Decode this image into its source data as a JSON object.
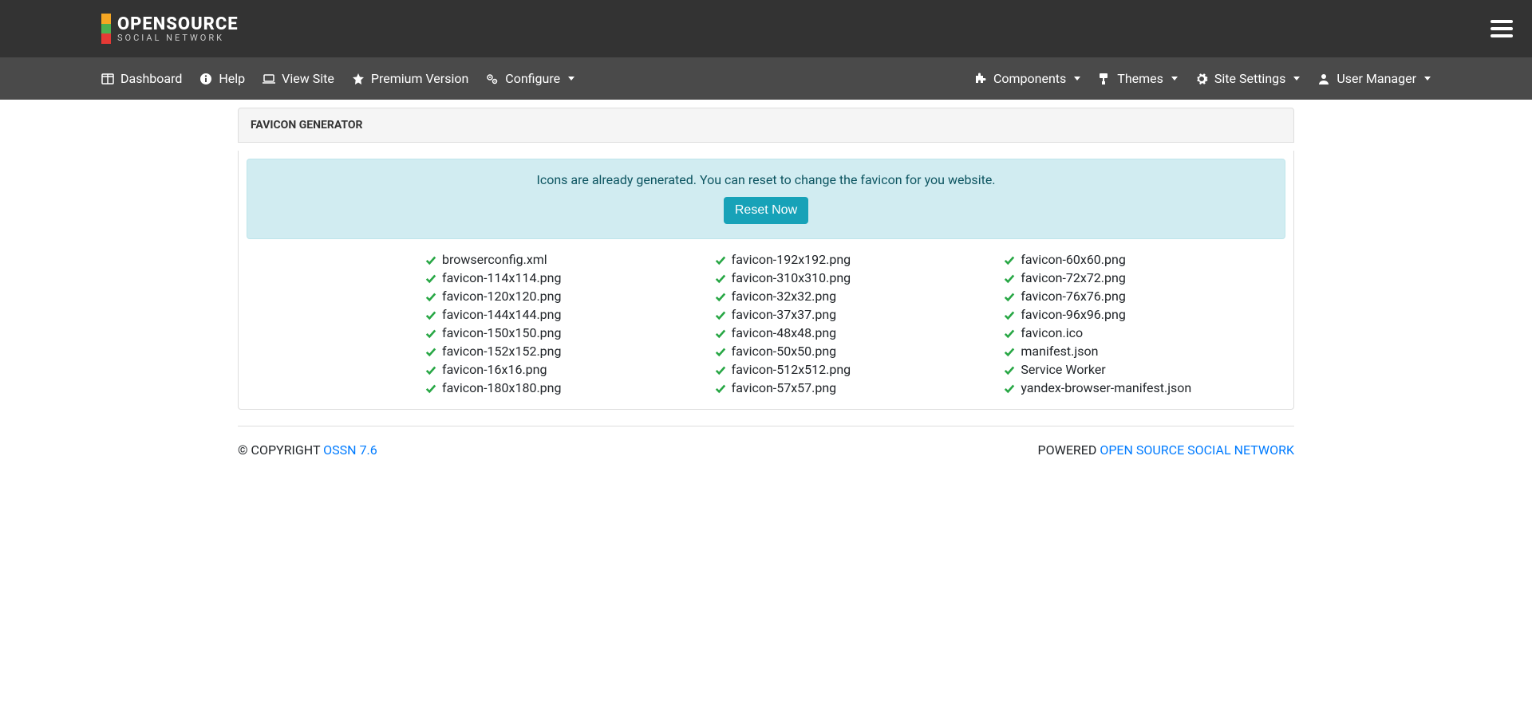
{
  "logo": {
    "line1": "OPENSOURCE",
    "line2": "SOCIAL NETWORK"
  },
  "nav": {
    "left": [
      {
        "key": "dashboard",
        "label": "Dashboard",
        "icon": "columns",
        "dropdown": false
      },
      {
        "key": "help",
        "label": "Help",
        "icon": "info",
        "dropdown": false
      },
      {
        "key": "view-site",
        "label": "View Site",
        "icon": "laptop",
        "dropdown": false
      },
      {
        "key": "premium",
        "label": "Premium Version",
        "icon": "star",
        "dropdown": false
      },
      {
        "key": "configure",
        "label": "Configure",
        "icon": "cogs",
        "dropdown": true
      }
    ],
    "right": [
      {
        "key": "components",
        "label": "Components",
        "icon": "puzzle",
        "dropdown": true
      },
      {
        "key": "themes",
        "label": "Themes",
        "icon": "paint",
        "dropdown": true
      },
      {
        "key": "site-settings",
        "label": "Site Settings",
        "icon": "cog",
        "dropdown": true
      },
      {
        "key": "user-manager",
        "label": "User Manager",
        "icon": "user",
        "dropdown": true
      }
    ]
  },
  "page": {
    "title": "FAVICON GENERATOR",
    "alert_text": "Icons are already generated. You can reset to change the favicon for you website.",
    "reset_button": "Reset Now"
  },
  "files": {
    "col1": [
      "browserconfig.xml",
      "favicon-114x114.png",
      "favicon-120x120.png",
      "favicon-144x144.png",
      "favicon-150x150.png",
      "favicon-152x152.png",
      "favicon-16x16.png",
      "favicon-180x180.png"
    ],
    "col2": [
      "favicon-192x192.png",
      "favicon-310x310.png",
      "favicon-32x32.png",
      "favicon-37x37.png",
      "favicon-48x48.png",
      "favicon-50x50.png",
      "favicon-512x512.png",
      "favicon-57x57.png"
    ],
    "col3": [
      "favicon-60x60.png",
      "favicon-72x72.png",
      "favicon-76x76.png",
      "favicon-96x96.png",
      "favicon.ico",
      "manifest.json",
      "Service Worker",
      "yandex-browser-manifest.json"
    ]
  },
  "footer": {
    "copyright_prefix": "© COPYRIGHT ",
    "copyright_link": "OSSN 7.6",
    "powered_prefix": "POWERED ",
    "powered_link": "OPEN SOURCE SOCIAL NETWORK"
  }
}
